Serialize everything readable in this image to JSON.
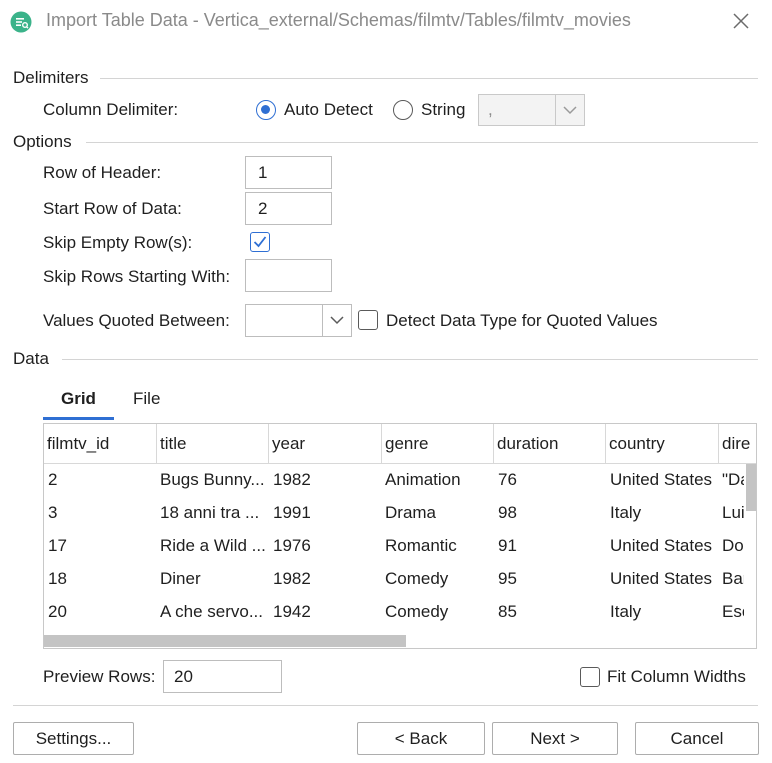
{
  "window": {
    "title": "Import Table Data - Vertica_external/Schemas/filmtv/Tables/filmtv_movies"
  },
  "delimiters": {
    "section_label": "Delimiters",
    "column_delimiter_label": "Column Delimiter:",
    "auto_detect_label": "Auto Detect",
    "string_label": "String",
    "string_value": ",",
    "selected": "Auto Detect"
  },
  "options": {
    "section_label": "Options",
    "row_of_header_label": "Row of Header:",
    "row_of_header_value": "1",
    "start_row_label": "Start Row of Data:",
    "start_row_value": "2",
    "skip_empty_label": "Skip Empty Row(s):",
    "skip_empty_checked": true,
    "skip_rows_starting_label": "Skip Rows Starting With:",
    "skip_rows_starting_value": "",
    "values_quoted_label": "Values Quoted Between:",
    "values_quoted_value": "",
    "detect_type_label": "Detect Data Type for Quoted Values",
    "detect_type_checked": false
  },
  "data": {
    "section_label": "Data",
    "tabs": [
      {
        "label": "Grid",
        "active": true
      },
      {
        "label": "File",
        "active": false
      }
    ],
    "columns": [
      "filmtv_id",
      "title",
      "year",
      "genre",
      "duration",
      "country",
      "dire"
    ],
    "rows": [
      [
        "2",
        "Bugs Bunny...",
        "1982",
        "Animation",
        "76",
        "United States",
        "\"Da"
      ],
      [
        "3",
        "18 anni tra ...",
        "1991",
        "Drama",
        "98",
        "Italy",
        "Lui"
      ],
      [
        "17",
        "Ride a Wild ...",
        "1976",
        "Romantic",
        "91",
        "United States",
        "Do"
      ],
      [
        "18",
        "Diner",
        "1982",
        "Comedy",
        "95",
        "United States",
        "Bar"
      ],
      [
        "20",
        "A che servo...",
        "1942",
        "Comedy",
        "85",
        "Italy",
        "Esc"
      ]
    ],
    "preview_rows_label": "Preview Rows:",
    "preview_rows_value": "20",
    "fit_columns_label": "Fit Column Widths",
    "fit_columns_checked": false
  },
  "buttons": {
    "settings": "Settings...",
    "back": "< Back",
    "next": "Next >",
    "cancel": "Cancel"
  },
  "colors": {
    "accent": "#2f6fd3",
    "app_icon": "#3bb38a"
  },
  "icons": {
    "app": "table-import-icon",
    "close": "close-icon",
    "dropdown": "chevron-down-icon",
    "check": "checkmark-icon"
  }
}
